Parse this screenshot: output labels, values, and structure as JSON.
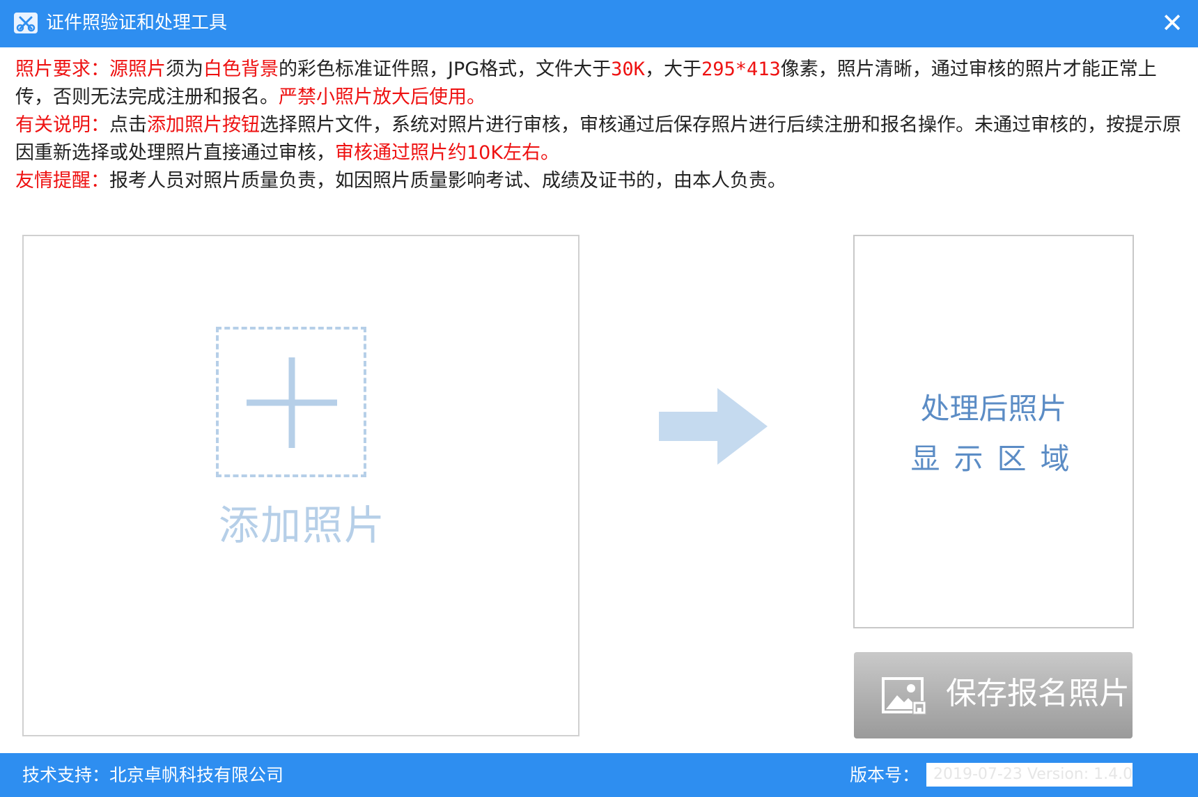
{
  "window": {
    "title": "证件照验证和处理工具",
    "close_symbol": "✕"
  },
  "notice": {
    "requirements": {
      "label": "照片要求：",
      "segments": [
        {
          "text": "源照片",
          "red": true
        },
        {
          "text": "须为",
          "red": false
        },
        {
          "text": "白色背景",
          "red": true
        },
        {
          "text": "的彩色标准证件照，JPG格式，文件大于",
          "red": false
        },
        {
          "text": "30K",
          "red": true
        },
        {
          "text": "，大于",
          "red": false
        },
        {
          "text": "295*413",
          "red": true
        },
        {
          "text": "像素，照片清晰，通过审核的照片才能正常上传，否则无法完成注册和报名。",
          "red": false
        },
        {
          "text": "严禁小照片放大后使用。",
          "red": true
        }
      ]
    },
    "explanation": {
      "label": "有关说明：",
      "segments": [
        {
          "text": "点击",
          "red": false
        },
        {
          "text": "添加照片按钮",
          "red": true
        },
        {
          "text": "选择照片文件，系统对照片进行审核，审核通过后保存照片进行后续注册和报名操作。未通过审核的，按提示原因重新选择或处理照片直接通过审核，",
          "red": false
        },
        {
          "text": "审核通过照片约10K左右。",
          "red": true
        }
      ]
    },
    "reminder": {
      "label": "友情提醒：",
      "segments": [
        {
          "text": "报考人员对照片质量负责，如因照片质量影响考试、成绩及证书的，由本人负责。",
          "red": false
        }
      ]
    }
  },
  "source_panel": {
    "add_label": "添加照片",
    "icon": "plus-icon"
  },
  "arrow": {
    "icon": "arrow-right-icon"
  },
  "result_panel": {
    "line1": "处理后照片",
    "line2": "显示区域"
  },
  "save_button": {
    "label": "保存报名照片",
    "icon": "image-save-icon"
  },
  "status_bar": {
    "support": "技术支持：北京卓帆科技有限公司",
    "version_label": "版本号：",
    "version_value": "2019-07-23 Version: 1.4.0"
  },
  "colors": {
    "accent": "#2e8ef0",
    "highlight_red": "#ee1111",
    "placeholder_blue": "#b6cfe8",
    "result_text": "#5b8cc5"
  }
}
